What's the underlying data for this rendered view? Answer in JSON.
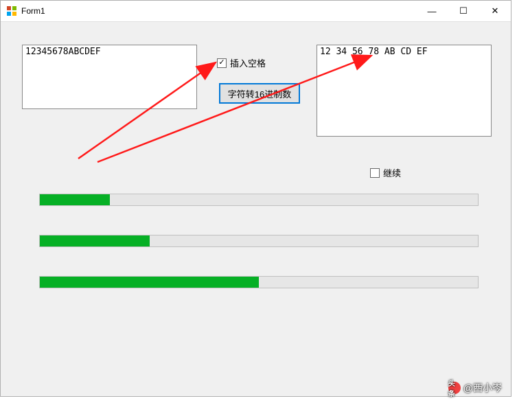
{
  "window": {
    "title": "Form1"
  },
  "input": {
    "value": "12345678ABCDEF"
  },
  "output": {
    "value": "12 34 56 78 AB CD EF"
  },
  "checkboxes": {
    "insert_space": {
      "label": "插入空格",
      "checked": true
    },
    "continue": {
      "label": "继续",
      "checked": false
    }
  },
  "buttons": {
    "convert": "字符转16进制数"
  },
  "progress": {
    "bar1": 16,
    "bar2": 25,
    "bar3": 50
  },
  "watermark": {
    "text": "@西小岑"
  },
  "icons": {
    "checkmark": "✓",
    "minimize": "—",
    "maximize": "☐",
    "close": "✕",
    "toutiao": "头条"
  }
}
